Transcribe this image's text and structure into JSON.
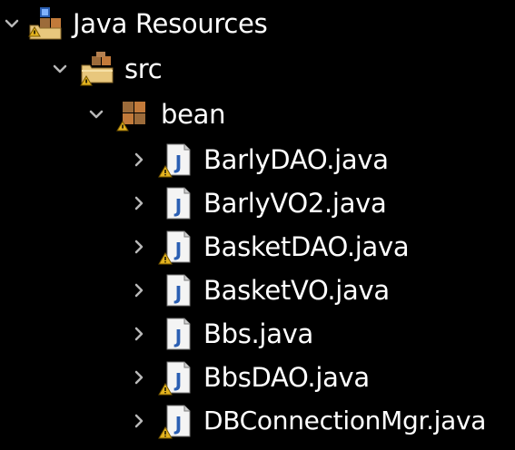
{
  "tree": {
    "root": {
      "label": "Java Resources",
      "icon": "java-resources-icon",
      "state": "expanded"
    },
    "src": {
      "label": "src",
      "icon": "package-folder-icon",
      "state": "expanded"
    },
    "package": {
      "label": "bean",
      "icon": "package-icon",
      "state": "expanded"
    },
    "files": [
      {
        "label": "BarlyDAO.java",
        "icon": "java-file-icon",
        "warning": true
      },
      {
        "label": "BarlyVO2.java",
        "icon": "java-file-icon",
        "warning": false
      },
      {
        "label": "BasketDAO.java",
        "icon": "java-file-icon",
        "warning": true
      },
      {
        "label": "BasketVO.java",
        "icon": "java-file-icon",
        "warning": false
      },
      {
        "label": "Bbs.java",
        "icon": "java-file-icon",
        "warning": false
      },
      {
        "label": "BbsDAO.java",
        "icon": "java-file-icon",
        "warning": true
      },
      {
        "label": "DBConnectionMgr.java",
        "icon": "java-file-icon",
        "warning": true
      }
    ]
  },
  "colors": {
    "background": "#000000",
    "text": "#ffffff",
    "chevron": "#b8b8b8",
    "java_icon_fill": "#f4f4f4",
    "java_letter": "#2b5fb3",
    "warning_yellow": "#e3b31f",
    "package_brown": "#9c6b3a",
    "folder_tan": "#e8c77d"
  }
}
